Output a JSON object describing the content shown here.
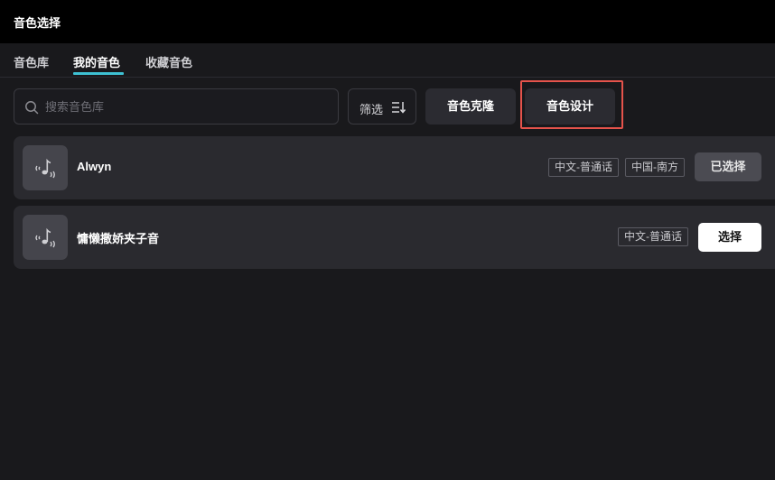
{
  "window": {
    "title": "音色选择"
  },
  "tabs": [
    {
      "label": "音色库",
      "active": false
    },
    {
      "label": "我的音色",
      "active": true
    },
    {
      "label": "收藏音色",
      "active": false
    }
  ],
  "search": {
    "placeholder": "搜索音色库",
    "value": "",
    "icon": "search-icon"
  },
  "filter": {
    "label": "筛选",
    "icon": "filter-sort-icon"
  },
  "toolbar": {
    "clone_label": "音色克隆",
    "design_label": "音色设计",
    "highlight_color": "#e5534b"
  },
  "voices": [
    {
      "name": "Alwyn",
      "icon": "voice-note-icon",
      "tags": [
        "中文-普通话",
        "中国-南方"
      ],
      "action_label": "已选择",
      "selected": true
    },
    {
      "name": "慵懒撒娇夹子音",
      "icon": "voice-note-icon",
      "tags": [
        "中文-普通话"
      ],
      "action_label": "选择",
      "selected": false
    }
  ],
  "colors": {
    "accent": "#3ec1d3",
    "background": "#19191c",
    "card": "#2a2a2f"
  }
}
